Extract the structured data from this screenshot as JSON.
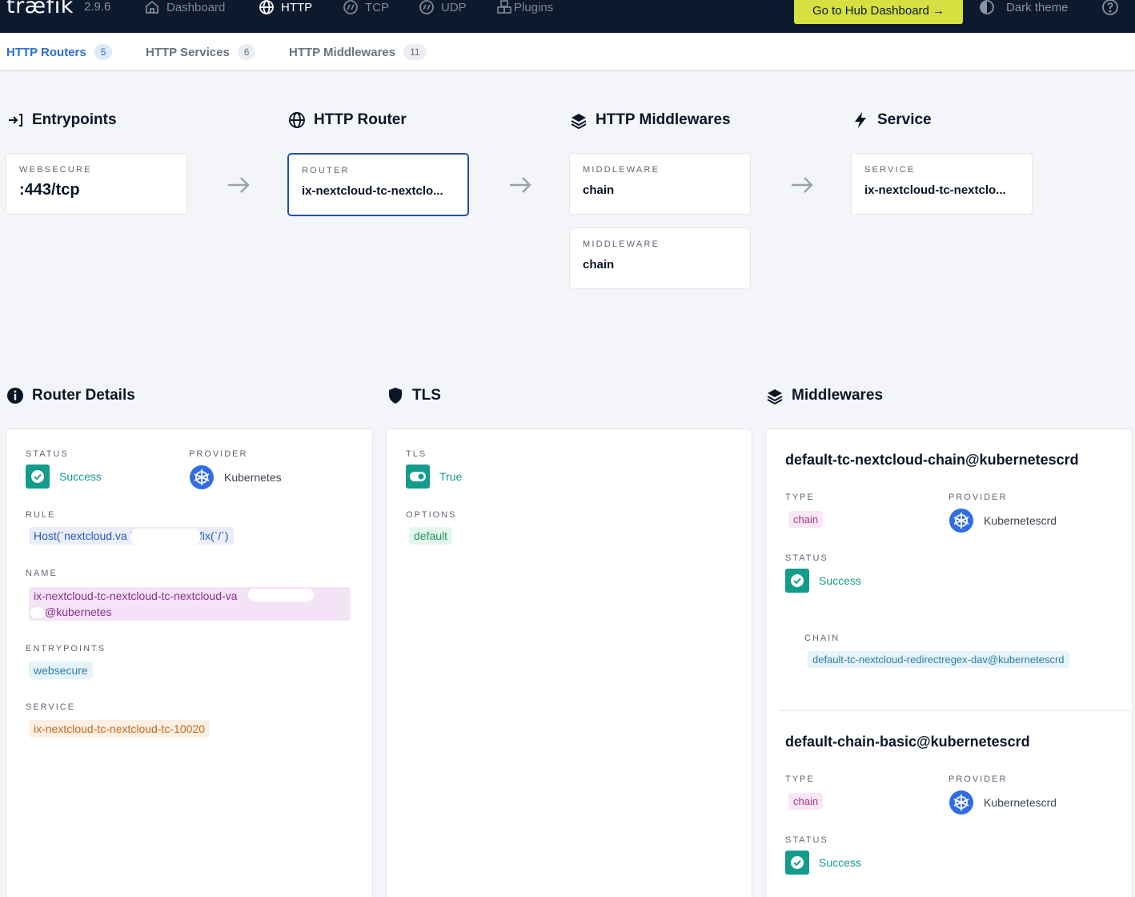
{
  "app": {
    "logo": "træfik",
    "version": "2.9.6"
  },
  "nav": {
    "items": [
      {
        "label": "Dashboard",
        "icon": "home-icon"
      },
      {
        "label": "HTTP",
        "icon": "globe-icon"
      },
      {
        "label": "TCP",
        "icon": "tcp-icon"
      },
      {
        "label": "UDP",
        "icon": "udp-icon"
      },
      {
        "label": "Plugins",
        "icon": "plugins-icon"
      }
    ],
    "hub_button": "Go to Hub Dashboard →",
    "theme_label": "Dark theme",
    "help_icon": "help-icon"
  },
  "subnav": {
    "tabs": [
      {
        "label": "HTTP Routers",
        "count": "5"
      },
      {
        "label": "HTTP Services",
        "count": "6"
      },
      {
        "label": "HTTP Middlewares",
        "count": "11"
      }
    ]
  },
  "flow": {
    "entrypoints": {
      "title": "Entrypoints",
      "label": "WEBSECURE",
      "value": ":443/tcp"
    },
    "router": {
      "title": "HTTP Router",
      "label": "ROUTER",
      "value": "ix-nextcloud-tc-nextclo..."
    },
    "middlewares": {
      "title": "HTTP Middlewares",
      "cards": [
        {
          "label": "MIDDLEWARE",
          "value": "chain"
        },
        {
          "label": "MIDDLEWARE",
          "value": "chain"
        }
      ]
    },
    "service": {
      "title": "Service",
      "label": "SERVICE",
      "value": "ix-nextcloud-tc-nextclo..."
    }
  },
  "router_details": {
    "title": "Router Details",
    "status_label": "STATUS",
    "status_value": "Success",
    "provider_label": "PROVIDER",
    "provider_value": "Kubernetes",
    "rule_label": "RULE",
    "rule_value": "Host(`nextcloud.va                    `) && PathPrefix(`/`)",
    "name_label": "NAME",
    "name_line1": "ix-nextcloud-tc-nextcloud-tc-nextcloud-va",
    "name_line2": "@kubernetes",
    "entrypoints_label": "ENTRYPOINTS",
    "entrypoints_value": "websecure",
    "service_label": "SERVICE",
    "service_value": "ix-nextcloud-tc-nextcloud-tc-10020"
  },
  "tls": {
    "title": "TLS",
    "tls_label": "TLS",
    "tls_value": "True",
    "options_label": "OPTIONS",
    "options_value": "default"
  },
  "middlewares_panel": {
    "title": "Middlewares",
    "items": [
      {
        "name": "default-tc-nextcloud-chain@kubernetescrd",
        "type_label": "TYPE",
        "type_value": "chain",
        "provider_label": "PROVIDER",
        "provider_value": "Kubernetescrd",
        "status_label": "STATUS",
        "status_value": "Success",
        "chain_label": "CHAIN",
        "chain_value": "default-tc-nextcloud-redirectregex-dav@kubernetescrd"
      },
      {
        "name": "default-chain-basic@kubernetescrd",
        "type_label": "TYPE",
        "type_value": "chain",
        "provider_label": "PROVIDER",
        "provider_value": "Kubernetescrd",
        "status_label": "STATUS",
        "status_value": "Success"
      }
    ]
  },
  "colors": {
    "navbar": "#0c1a2e",
    "accent": "#2d6fd0",
    "hub_button": "#d6e041",
    "success": "#139c8c",
    "kubernetes": "#326ce5"
  }
}
